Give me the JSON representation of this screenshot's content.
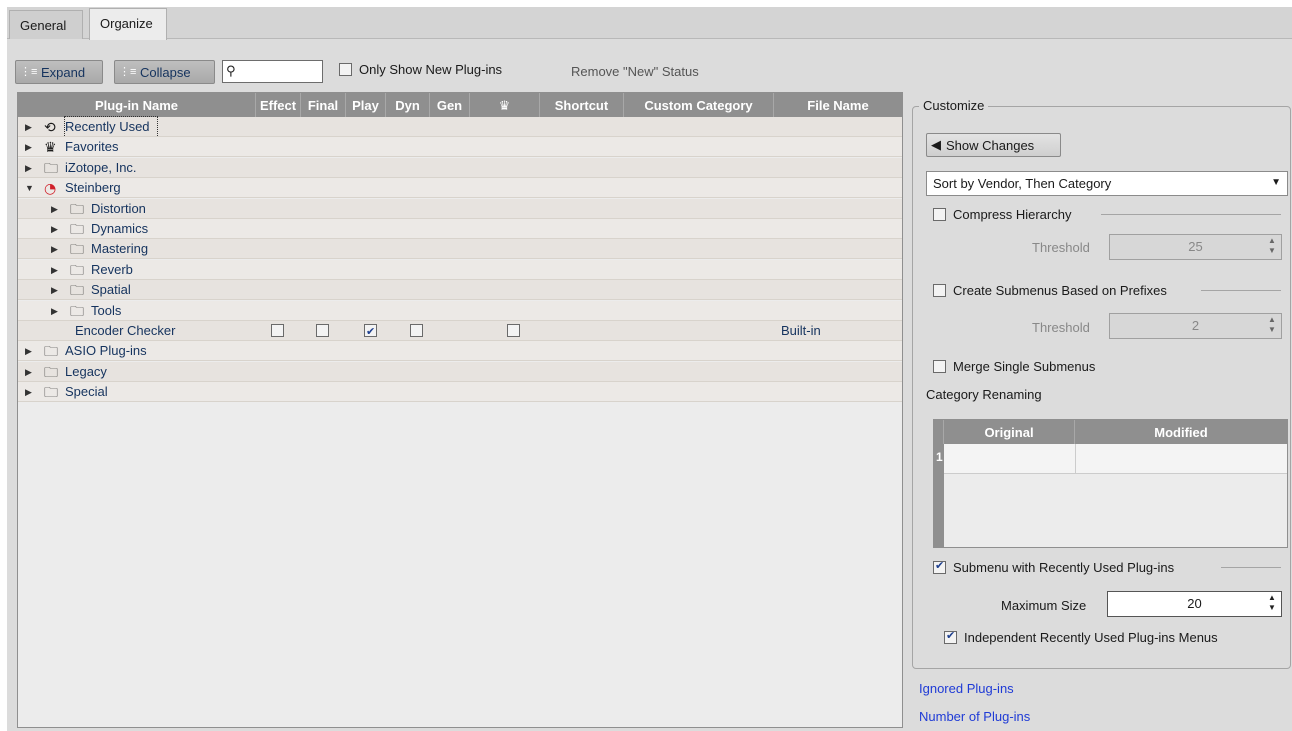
{
  "tabs": [
    "General",
    "Organize"
  ],
  "toolbar": {
    "expand": "Expand",
    "collapse": "Collapse",
    "search_value": "",
    "only_new": "Only Show New Plug-ins",
    "remove_new": "Remove \"New\" Status"
  },
  "columns": [
    "Plug-in Name",
    "Effect",
    "Final",
    "Play",
    "Dyn",
    "Gen",
    "crown-icon",
    "Shortcut",
    "Custom Category",
    "File Name"
  ],
  "tree": [
    {
      "label": "Recently Used",
      "icon": "clock-icon",
      "level": 0
    },
    {
      "label": "Favorites",
      "icon": "crown-icon",
      "level": 0
    },
    {
      "label": "iZotope, Inc.",
      "icon": "folder-icon",
      "level": 0
    },
    {
      "label": "Steinberg",
      "icon": "steinberg-icon",
      "level": 0
    },
    {
      "label": "Distortion",
      "icon": "folder-icon",
      "level": 1
    },
    {
      "label": "Dynamics",
      "icon": "folder-icon",
      "level": 1
    },
    {
      "label": "Mastering",
      "icon": "folder-icon",
      "level": 1
    },
    {
      "label": "Reverb",
      "icon": "folder-icon",
      "level": 1
    },
    {
      "label": "Spatial",
      "icon": "folder-icon",
      "level": 1
    },
    {
      "label": "Tools",
      "icon": "folder-icon",
      "level": 1
    },
    {
      "label": "Encoder Checker",
      "icon": "",
      "level": 2,
      "file": "Built-in",
      "checks": [
        false,
        false,
        true,
        false,
        false
      ]
    },
    {
      "label": "ASIO Plug-ins",
      "icon": "folder-icon",
      "level": 0
    },
    {
      "label": "Legacy",
      "icon": "folder-icon",
      "level": 0
    },
    {
      "label": "Special",
      "icon": "folder-icon",
      "level": 0
    }
  ],
  "customize": {
    "title": "Customize",
    "show_changes": "Show Changes",
    "sort": "Sort by Vendor, Then Category",
    "compress": "Compress Hierarchy",
    "threshold_label": "Threshold",
    "threshold1": "25",
    "submenus_prefix": "Create Submenus Based on Prefixes",
    "threshold2": "2",
    "merge": "Merge Single Submenus",
    "renaming": "Category Renaming",
    "col_original": "Original",
    "col_modified": "Modified",
    "row_num": "1",
    "recent_submenu": "Submenu with Recently Used Plug-ins",
    "max_size_label": "Maximum Size",
    "max_size": "20",
    "independent": "Independent Recently Used Plug-ins Menus"
  },
  "links": {
    "ignored": "Ignored Plug-ins",
    "number": "Number of Plug-ins"
  }
}
